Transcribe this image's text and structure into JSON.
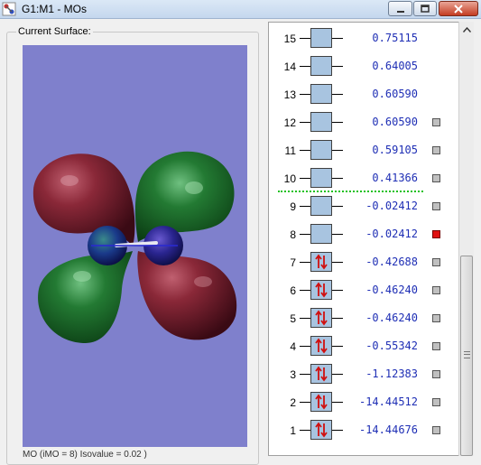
{
  "window": {
    "title": "G1:M1 - MOs"
  },
  "left_panel": {
    "group_label": "Current Surface:",
    "bottom_text": "MO (iMO = 8) Isovalue = 0.02 )"
  },
  "mo_list": {
    "orbitals": [
      {
        "num": "15",
        "energy": "0.75115",
        "occupied": false,
        "has_checkbox": false,
        "selected": false
      },
      {
        "num": "14",
        "energy": "0.64005",
        "occupied": false,
        "has_checkbox": false,
        "selected": false
      },
      {
        "num": "13",
        "energy": "0.60590",
        "occupied": false,
        "has_checkbox": false,
        "selected": false
      },
      {
        "num": "12",
        "energy": "0.60590",
        "occupied": false,
        "has_checkbox": true,
        "selected": false
      },
      {
        "num": "11",
        "energy": "0.59105",
        "occupied": false,
        "has_checkbox": true,
        "selected": false
      },
      {
        "num": "10",
        "energy": "0.41366",
        "occupied": false,
        "has_checkbox": true,
        "selected": false
      },
      {
        "num": "9",
        "energy": "-0.02412",
        "occupied": false,
        "has_checkbox": true,
        "selected": false
      },
      {
        "num": "8",
        "energy": "-0.02412",
        "occupied": false,
        "has_checkbox": true,
        "selected": true
      },
      {
        "num": "7",
        "energy": "-0.42688",
        "occupied": true,
        "has_checkbox": true,
        "selected": false
      },
      {
        "num": "6",
        "energy": "-0.46240",
        "occupied": true,
        "has_checkbox": true,
        "selected": false
      },
      {
        "num": "5",
        "energy": "-0.46240",
        "occupied": true,
        "has_checkbox": true,
        "selected": false
      },
      {
        "num": "4",
        "energy": "-0.55342",
        "occupied": true,
        "has_checkbox": true,
        "selected": false
      },
      {
        "num": "3",
        "energy": "-1.12383",
        "occupied": true,
        "has_checkbox": true,
        "selected": false
      },
      {
        "num": "2",
        "energy": "-14.44512",
        "occupied": true,
        "has_checkbox": true,
        "selected": false
      },
      {
        "num": "1",
        "energy": "-14.44676",
        "occupied": true,
        "has_checkbox": true,
        "selected": false
      }
    ]
  },
  "colors": {
    "viewport_bg": "#7f80cc",
    "lobe_red": "#7a1a2a",
    "lobe_green": "#1d6a2a",
    "atom": "#1a1a8a",
    "energy_text": "#1f2fb5",
    "homo_lumo_divider": "#1fc11f",
    "selected_marker": "#e01010"
  },
  "icons": {
    "app": "gaussview-app-icon",
    "minimize": "minimize-icon",
    "maximize": "maximize-icon",
    "close": "close-icon",
    "scroll_up": "scroll-up-arrow-icon",
    "electron_pair": "spin-up-down-arrows-icon"
  }
}
